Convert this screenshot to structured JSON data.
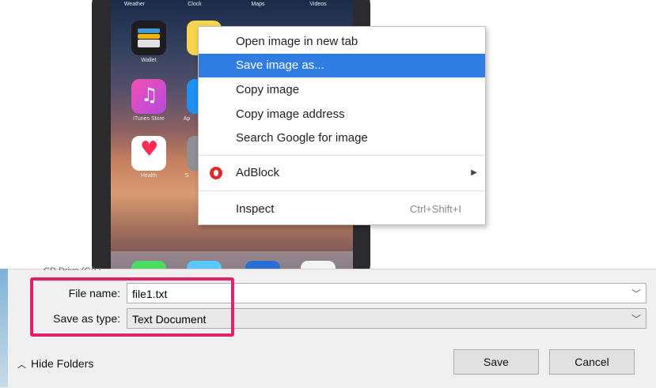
{
  "phone": {
    "apps_top": [
      "Weather",
      "Clock",
      "Maps",
      "Videos"
    ],
    "apps_row1_label": "Wallet",
    "apps_row2_labels": [
      "iTunes Store",
      "Ap"
    ],
    "apps_row3_labels": [
      "Health",
      "S"
    ]
  },
  "context_menu": {
    "items": [
      {
        "label": "Open image in new tab"
      },
      {
        "label": "Save image as..."
      },
      {
        "label": "Copy image"
      },
      {
        "label": "Copy image address"
      },
      {
        "label": "Search Google for image"
      },
      {
        "label": "AdBlock"
      },
      {
        "label": "Inspect",
        "shortcut": "Ctrl+Shift+I"
      }
    ],
    "highlight_color": "#2f7de1"
  },
  "dialog": {
    "partial_text": "CD Drive (G:) L",
    "file_name_label": "File name:",
    "file_name_value": "file1.txt",
    "save_type_label": "Save as type:",
    "save_type_value": "Text Document",
    "hide_folders": "Hide Folders",
    "save_button": "Save",
    "cancel_button": "Cancel",
    "highlight_color": "#e4206a"
  }
}
